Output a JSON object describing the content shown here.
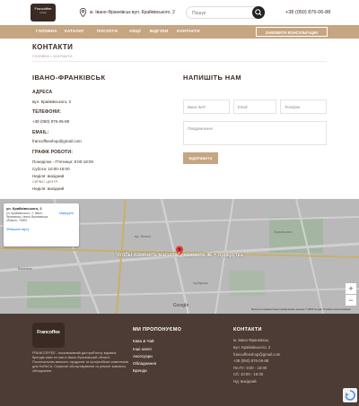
{
  "header": {
    "logo_text": "Francoffee",
    "logo_sub": "coffee",
    "address": "м. Івано-Франківськ вул. Крайківського, 2",
    "search_placeholder": "Пошук",
    "phone": "+38 (050) 876-06-88"
  },
  "nav": {
    "items": [
      "ГОЛОВНА",
      "КАТАЛОГ",
      "ПОСЛУГИ",
      "АКЦІЇ",
      "ВІДГУКИ",
      "КОНТАКТИ"
    ],
    "consult_button": "ЗАМОВИТИ КОНСУЛЬТАЦІЮ"
  },
  "page": {
    "title": "КОНТАКТИ",
    "breadcrumb": "ГОЛОВНА  >  КОНТАКТИ"
  },
  "contacts": {
    "city": "ІВАНО-ФРАНКІВСЬК",
    "address_label": "АДРЕСА",
    "address_value": "вул. Крайківського, 2",
    "phone_label": "ТЕЛЕФОНИ:",
    "phone_value": "+38 (050) 876-06-88",
    "email_label": "EMAIL:",
    "email_value": "francoffeeshop@gmail.com",
    "hours_label": "ГРАФІК РОБОТИ:",
    "hours": [
      "Понеділок - П'ятниця: 9:00-18:00",
      "Субота: 10:00-15:00",
      "Неділя: вихідний",
      "СЕРВІС ЦЕНТР:",
      "Неділя: вихідний"
    ]
  },
  "form": {
    "title": "НАПИШІТЬ НАМ",
    "name_placeholder": "Ваше ім'я*",
    "email_placeholder": "Email",
    "phone_placeholder": "Телефон",
    "message_placeholder": "Повідомлення",
    "submit": "ВІДПРАВИТИ"
  },
  "map": {
    "card_title": "ул. Крайківського, 2",
    "card_address": "ул. Крайківського, 2, Івано-Франківськ, Івано-Франківська область, 76000",
    "card_route": "Маршрути",
    "card_larger": "Збільшити карту",
    "hint": "Чтобы изменить масштаб, нажмите ⌘ + прокрутка",
    "footer_text": "Быстрые клавиши   Картографические данные © 2023 Google   Условия использования",
    "brand": "Google",
    "streets": [
      "вул. Мазепи",
      "Вокзальна",
      "Гарбарська",
      "Паркова зона"
    ],
    "zoom_in": "+",
    "zoom_out": "−"
  },
  "footer": {
    "logo_text": "Francoffee",
    "description": "FRANCOFFEE - ексклюзивний дистриб'ютор відомих брендів кави та чаю в Івано-Франківській області. Постачальник звеколи, продуктів та професійних комплексів для HoReCa. Сервісне обслуговування та ремонт кавового обладнання.",
    "offer_head": "МИ ПРОПОНУЄМО",
    "offer_links": [
      "Кава & Чай",
      "Інші напої",
      "Аксесуари",
      "Обладнання",
      "Бренди"
    ],
    "contact_head": "КОНТАКТИ",
    "contact_lines": [
      "м. Івано-Франківськ,",
      "вул. Крайківського, 2",
      "francoffeeshop@gmail.com",
      "+38 (050) 876-06-88",
      "Пн-Пт: 9:00 - 18:00",
      "Сб: 10:00 - 15:00",
      "Нд: вихідний"
    ]
  },
  "colors": {
    "accent": "#c6a581",
    "dark": "#3a2b25",
    "footer": "#4d3b35"
  }
}
